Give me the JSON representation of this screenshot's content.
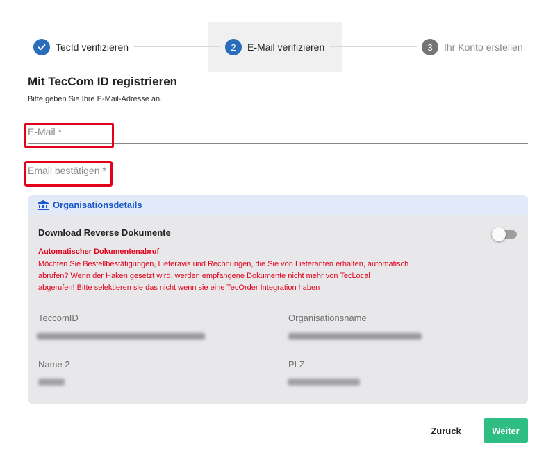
{
  "stepper": {
    "steps": [
      {
        "label": "TecId verifizieren",
        "state": "completed",
        "icon": "check-icon"
      },
      {
        "label": "E-Mail verifizieren",
        "number": "2",
        "state": "active"
      },
      {
        "label": "Ihr Konto erstellen",
        "number": "3",
        "state": "pending"
      }
    ]
  },
  "form": {
    "title": "Mit TecCom ID registrieren",
    "subtitle": "Bitte geben Sie Ihre E-Mail-Adresse an.",
    "email_placeholder": "E-Mail *",
    "email_confirm_placeholder": "Email bestätigen *"
  },
  "org": {
    "header": "Organisationsdetails",
    "header_icon": "bank-icon",
    "download_label": "Download Reverse Dokumente",
    "toggle_on": false,
    "warning_title": "Automatischer Dokumentenabruf",
    "warning_lines": [
      "Möchten Sie Bestellbestätigungen, Lieferavis und Rechnungen, die Sie von Lieferanten erhalten, automatisch",
      "abrufen? Wenn der Haken gesetzt wird, werden empfangene Dokumente nicht mehr von TecLocal",
      "abgerufen! Bitte selektieren sie das nicht wenn sie eine TecOrder Integration haben"
    ],
    "fields": [
      {
        "label": "TeccomID"
      },
      {
        "label": "Organisationsname"
      },
      {
        "label": "Name 2"
      },
      {
        "label": "PLZ"
      }
    ]
  },
  "buttons": {
    "back": "Zurück",
    "next": "Weiter"
  },
  "colors": {
    "accent": "#2a6ebb",
    "success": "#2ebd83",
    "warning": "#e2001a",
    "link": "#1a57c9",
    "highlight": "#e2001a"
  }
}
